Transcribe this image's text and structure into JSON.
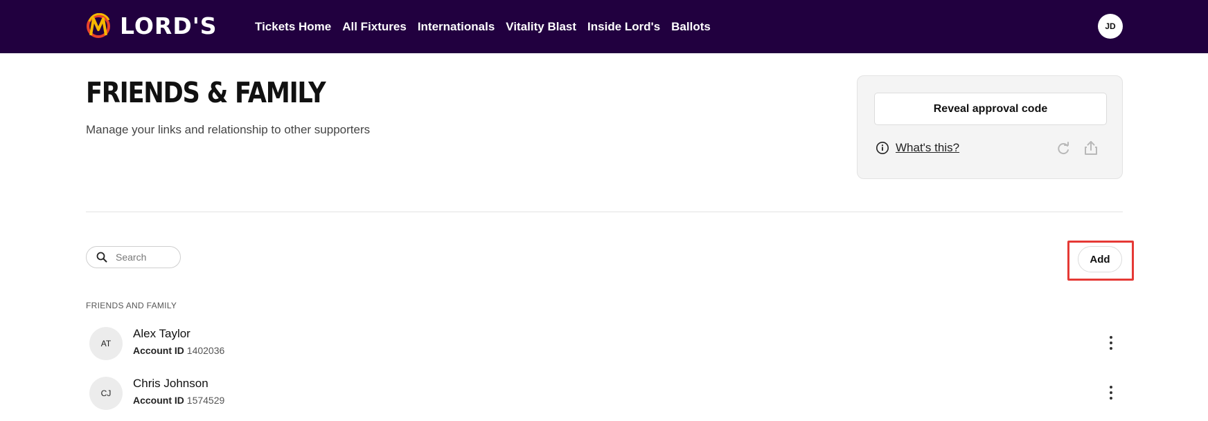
{
  "header": {
    "logo_text": "LORD'S",
    "nav": [
      "Tickets Home",
      "All Fixtures",
      "Internationals",
      "Vitality Blast",
      "Inside Lord's",
      "Ballots"
    ],
    "user_initials": "JD",
    "background_color": "#21003f"
  },
  "page": {
    "title": "FRIENDS & FAMILY",
    "subtitle": "Manage your links and relationship to other supporters"
  },
  "approval": {
    "reveal_label": "Reveal approval code",
    "whats_this": "What's this?",
    "icons": [
      "info-icon",
      "refresh-icon",
      "share-icon"
    ]
  },
  "search": {
    "placeholder": "Search",
    "icon": "search-icon"
  },
  "toolbar": {
    "add_label": "Add",
    "highlight_color": "#e53935"
  },
  "list": {
    "section_label": "FRIENDS AND FAMILY",
    "account_label": "Account ID",
    "members": [
      {
        "initials": "AT",
        "name": "Alex Taylor",
        "account_id": "1402036"
      },
      {
        "initials": "CJ",
        "name": "Chris Johnson",
        "account_id": "1574529"
      }
    ]
  }
}
